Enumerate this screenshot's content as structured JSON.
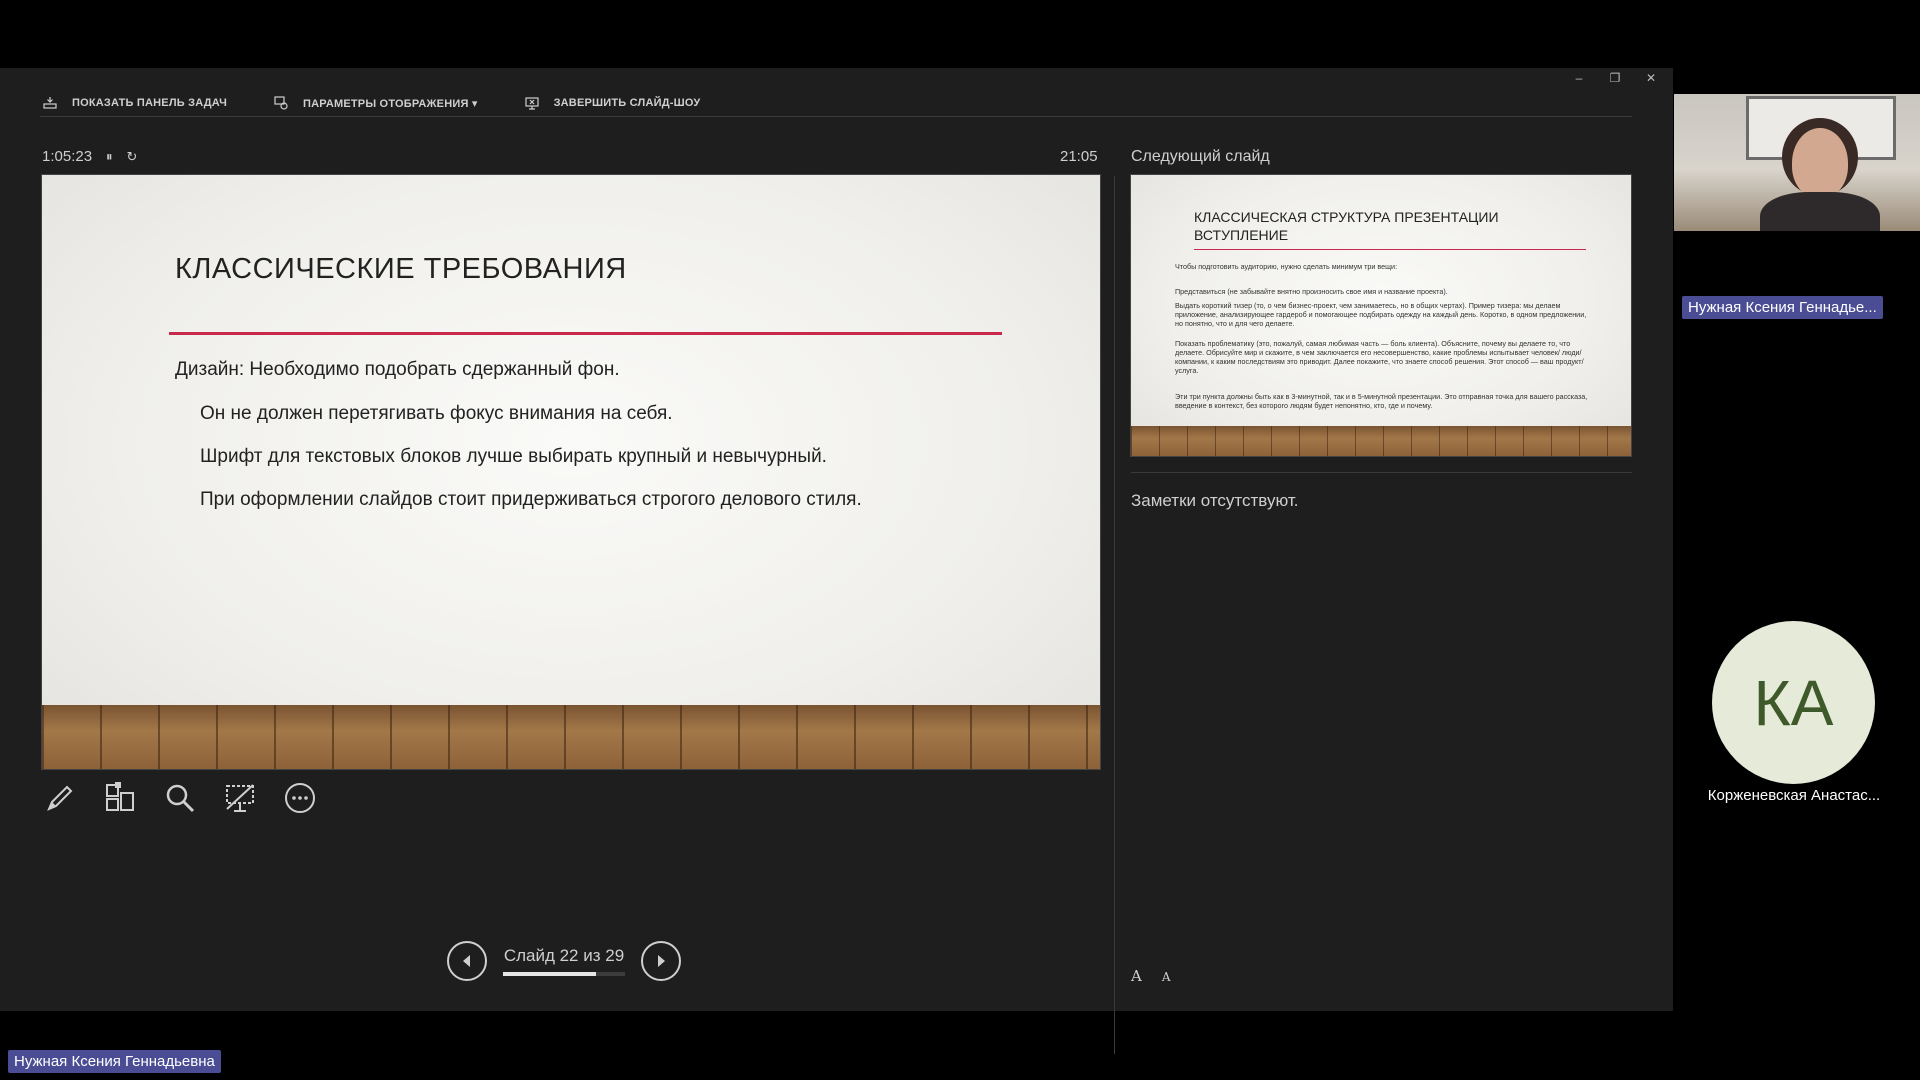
{
  "toolbar": {
    "show_taskbar": "ПОКАЗАТЬ ПАНЕЛЬ ЗАДАЧ",
    "display_settings": "ПАРАМЕТРЫ ОТОБРАЖЕНИЯ ▾",
    "end_show": "ЗАВЕРШИТЬ СЛАЙД-ШОУ"
  },
  "window": {
    "minimize": "–",
    "restore": "❐",
    "close": "✕"
  },
  "timer": {
    "elapsed": "1:05:23",
    "pause": "⏸",
    "reset": "↻"
  },
  "clock": "21:05",
  "current_slide": {
    "title": "КЛАССИЧЕСКИЕ ТРЕБОВАНИЯ",
    "design_line": "Дизайн: Необходимо подобрать сдержанный фон.",
    "bullets": [
      "Он не должен перетягивать фокус внимания на себя.",
      "Шрифт для текстовых блоков лучше выбирать крупный и невычурный.",
      "При оформлении слайдов стоит придерживаться строгого делового стиля."
    ]
  },
  "next_slide": {
    "label": "Следующий слайд",
    "title_line1": "КЛАССИЧЕСКАЯ СТРУКТУРА ПРЕЗЕНТАЦИИ",
    "title_line2": "ВСТУПЛЕНИЕ",
    "paragraphs": [
      "Чтобы подготовить аудиторию, нужно сделать минимум три вещи:",
      "Представиться (не забывайте внятно произносить свое имя и название проекта).",
      "Выдать короткий тизер (то, о чем бизнес-проект, чем занимаетесь, но в общих чертах). Пример тизера: мы делаем приложение, анализирующее гардероб и помогающее подбирать одежду на каждый день. Коротко, в одном предложении, но понятно, что и для чего делаете.",
      "Показать проблематику (это, пожалуй, самая любимая часть — боль клиента). Объясните, почему вы делаете то, что делаете. Обрисуйте мир и скажите, в чем заключается его несовершенство, какие проблемы испытывает человек/ люди/ компании, к каким последствиям это приводит. Далее покажите, что знаете способ решения. Этот способ — ваш продукт/ услуга.",
      "Эти три пункта должны быть как в 3-минутной, так и в 5-минутной презентации. Это отправная точка для вашего рассказа, введение в контекст, без которого людям будет непонятно, кто, где и почему."
    ]
  },
  "notes": "Заметки отсутствуют.",
  "font_controls": {
    "increase": "A",
    "decrease": "A"
  },
  "navigation": {
    "counter": "Слайд 22 из 29",
    "current": 22,
    "total": 29,
    "progress": 0.759
  },
  "participants": {
    "video_name": "Нужная Ксения Геннадье...",
    "avatar_initials": "КА",
    "avatar_name": "Корженевская Анастас...",
    "self_name": "Нужная Ксения Геннадьевна"
  }
}
